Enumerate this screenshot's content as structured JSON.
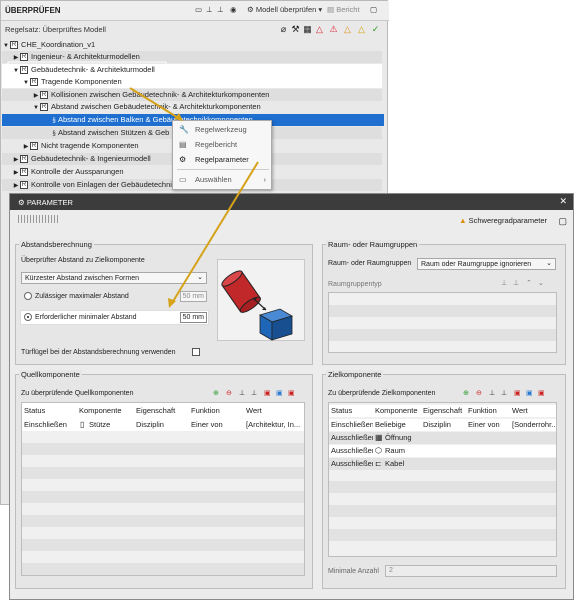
{
  "back_panel": {
    "title": "ÜBERPRÜFEN",
    "toolbar": {
      "model_check_label": "Modell überprüfen",
      "report_label": "Bericht"
    },
    "ruleset_label": "Regelsatz: Überprüftes Modell",
    "tree": [
      "CHE_Koordination_v1",
      "Ingenieur- & Architekturmodellen",
      "Gebäudetechnik- & Architekturmodell",
      "Tragende Komponenten",
      "Kollisionen zwischen Gebäudetechnik- & Architekturkomponenten",
      "Abstand zwischen Gebäudetechnik- & Architekturkomponenten",
      "Abstand zwischen Balken & Gebäudetechnikkomponenten",
      "Abstand zwischen Stützen & Geb",
      "Nicht tragende Komponenten",
      "Gebäudetechnik- & Ingenieurmodell",
      "Kontrolle der Aussparungen",
      "Kontrolle von Einlagen der Gebäudetechnik"
    ]
  },
  "context_menu": [
    "Regelwerkzeug",
    "Regelbericht",
    "Regelparameter",
    "Auswählen"
  ],
  "dialog": {
    "title": "PARAMETER",
    "severity_label": "Schweregradparameter",
    "abstand": {
      "title": "Abstandsberechnung",
      "checked_label": "Überprüfter Abstand zu Zielkomponente",
      "select_value": "Kürzester Abstand zwischen Formen",
      "max_label": "Zulässiger maximaler Abstand",
      "max_value": "50 mm",
      "min_label": "Erforderlicher minimaler Abstand",
      "min_value": "50 mm",
      "doors_label": "Türflügel bei der Abstandsberechnung verwenden"
    },
    "raum": {
      "title": "Raum- oder Raumgruppen",
      "label": "Raum- oder Raumgruppen",
      "select_value": "Raum oder Raumgruppe ignorieren",
      "type_label": "Raumgruppentyp"
    },
    "quell": {
      "title": "Quellkomponente",
      "subtitle": "Zu überprüfende Quellkomponenten",
      "headers": [
        "Status",
        "Komponente",
        "Eigenschaft",
        "Funktion",
        "Wert"
      ],
      "rows": [
        [
          "Einschließen",
          "Stütze",
          "Disziplin",
          "Einer von",
          "[Architektur, In..."
        ]
      ]
    },
    "ziel": {
      "title": "Zielkomponente",
      "subtitle": "Zu überprüfende Zielkomponenten",
      "headers": [
        "Status",
        "Komponente",
        "Eigenschaft",
        "Funktion",
        "Wert"
      ],
      "rows": [
        [
          "Einschließen",
          "Beliebige",
          "Disziplin",
          "Einer von",
          "[Sonderrohr..."
        ],
        [
          "Ausschließen",
          "Öffnung",
          "",
          "",
          ""
        ],
        [
          "Ausschließen",
          "Raum",
          "",
          "",
          ""
        ],
        [
          "Ausschließen",
          "Kabel",
          "",
          "",
          ""
        ]
      ],
      "min_count_label": "Minimale Anzahl",
      "min_count_value": "2"
    }
  },
  "colors": {
    "selection": "#1f6fd1",
    "arrow": "#d6a21a",
    "cylinder": "#c0282a",
    "cube": "#1e66b8"
  }
}
